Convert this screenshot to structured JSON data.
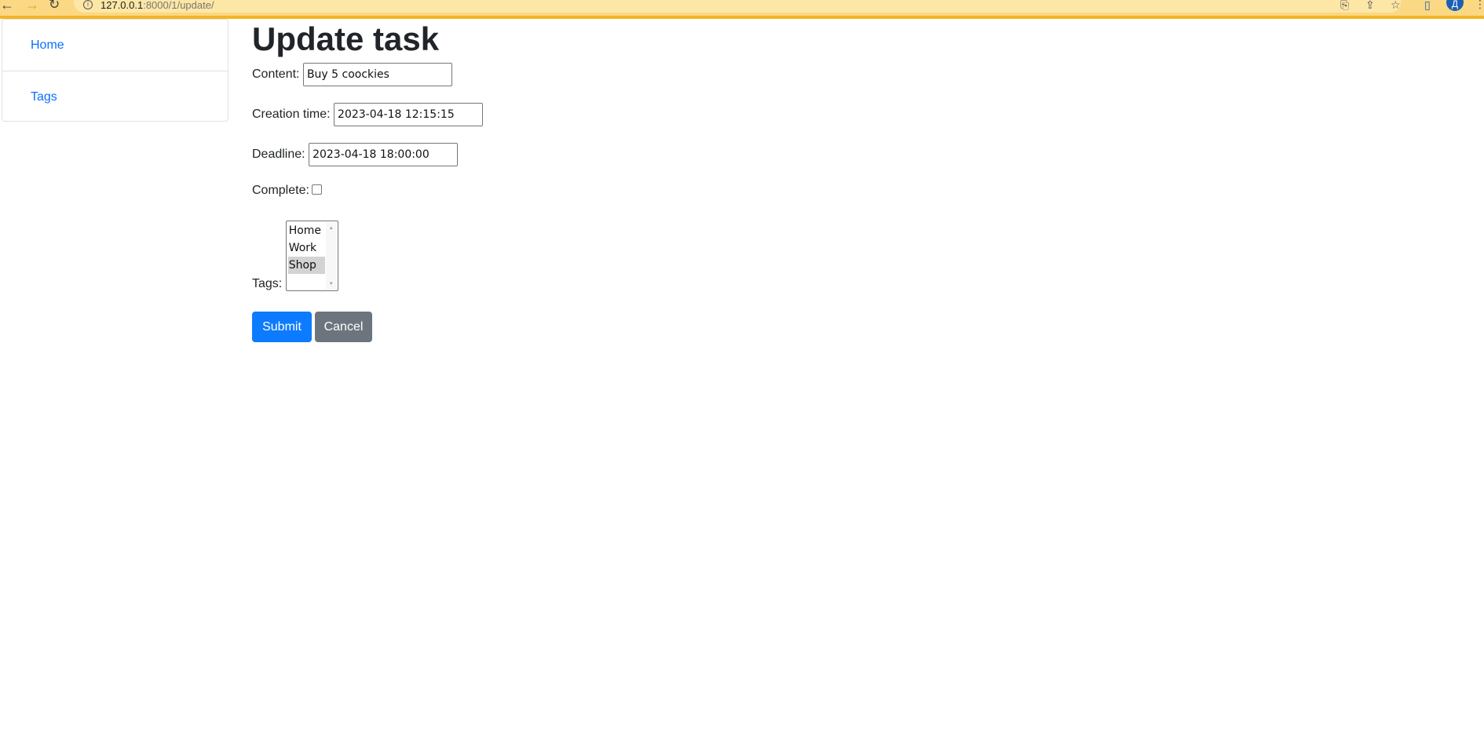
{
  "browser": {
    "url_host": "127.0.0.1",
    "url_path": ":8000/1/update/",
    "profile_initial": "Д"
  },
  "sidebar": {
    "items": [
      {
        "label": "Home"
      },
      {
        "label": "Tags"
      }
    ]
  },
  "page": {
    "title": "Update task"
  },
  "form": {
    "content": {
      "label": "Content:",
      "value": "Buy 5 coockies"
    },
    "creation_time": {
      "label": "Creation time:",
      "value": "2023-04-18 12:15:15"
    },
    "deadline": {
      "label": "Deadline:",
      "value": "2023-04-18 18:00:00"
    },
    "complete": {
      "label": "Complete:",
      "checked": false
    },
    "tags": {
      "label": "Tags:",
      "options": [
        "Home",
        "Work",
        "Shop"
      ],
      "selected": "Shop"
    },
    "submit_label": "Submit",
    "cancel_label": "Cancel"
  },
  "colors": {
    "link": "#0d6efd",
    "primary": "#0d7bfe",
    "secondary": "#6c757d",
    "chrome_bar": "#fbd883"
  }
}
